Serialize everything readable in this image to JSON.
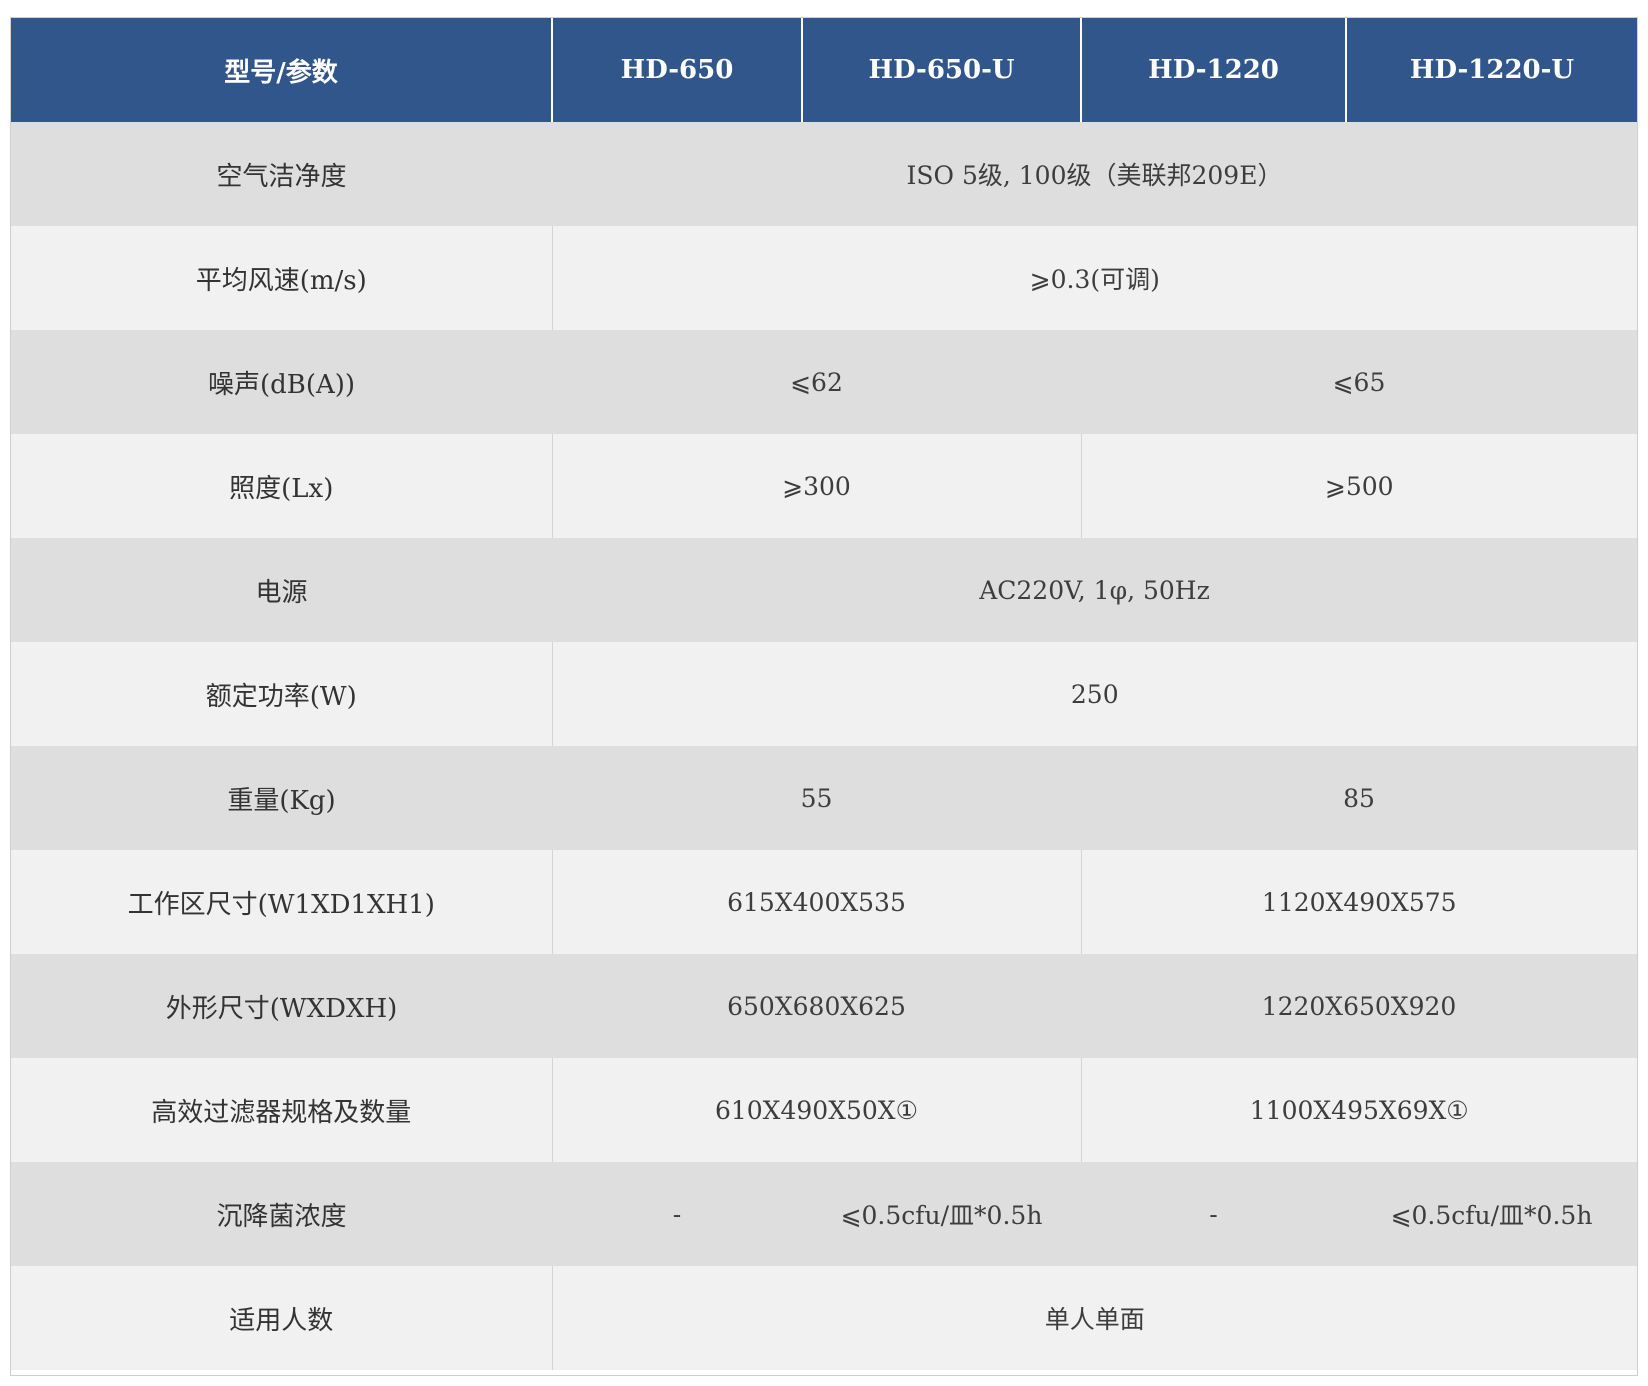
{
  "table": {
    "headers": [
      "型号/参数",
      "HD-650",
      "HD-650-U",
      "HD-1220",
      "HD-1220-U"
    ],
    "rows": {
      "cleanliness": {
        "label": "空气洁净度",
        "value": "ISO 5级, 100级（美联邦209E）"
      },
      "air_speed": {
        "label": "平均风速(m/s)",
        "value": "⩾0.3(可调)"
      },
      "noise": {
        "label": "噪声(dB(A))",
        "hd650": "⩽62",
        "hd1220": "⩽65"
      },
      "illuminance": {
        "label": "照度(Lx)",
        "hd650": "⩾300",
        "hd1220": "⩾500"
      },
      "power_supply": {
        "label": "电源",
        "value": "AC220V, 1φ, 50Hz"
      },
      "rated_power": {
        "label": "额定功率(W)",
        "value": "250"
      },
      "weight": {
        "label": "重量(Kg)",
        "hd650": "55",
        "hd1220": "85"
      },
      "work_area": {
        "label": "工作区尺寸(W1XD1XH1)",
        "hd650": "615X400X535",
        "hd1220": "1120X490X575"
      },
      "dimensions": {
        "label": "外形尺寸(WXDXH)",
        "hd650": "650X680X625",
        "hd1220": "1220X650X920"
      },
      "hepa_filter": {
        "label": "高效过滤器规格及数量",
        "hd650": "610X490X50X①",
        "hd1220": "1100X495X69X①"
      },
      "sedimentation": {
        "label": "沉降菌浓度",
        "hd650": "-",
        "hd650u": "⩽0.5cfu/皿*0.5h",
        "hd1220": "-",
        "hd1220u": "⩽0.5cfu/皿*0.5h"
      },
      "users": {
        "label": "适用人数",
        "value": "单人单面"
      }
    }
  }
}
